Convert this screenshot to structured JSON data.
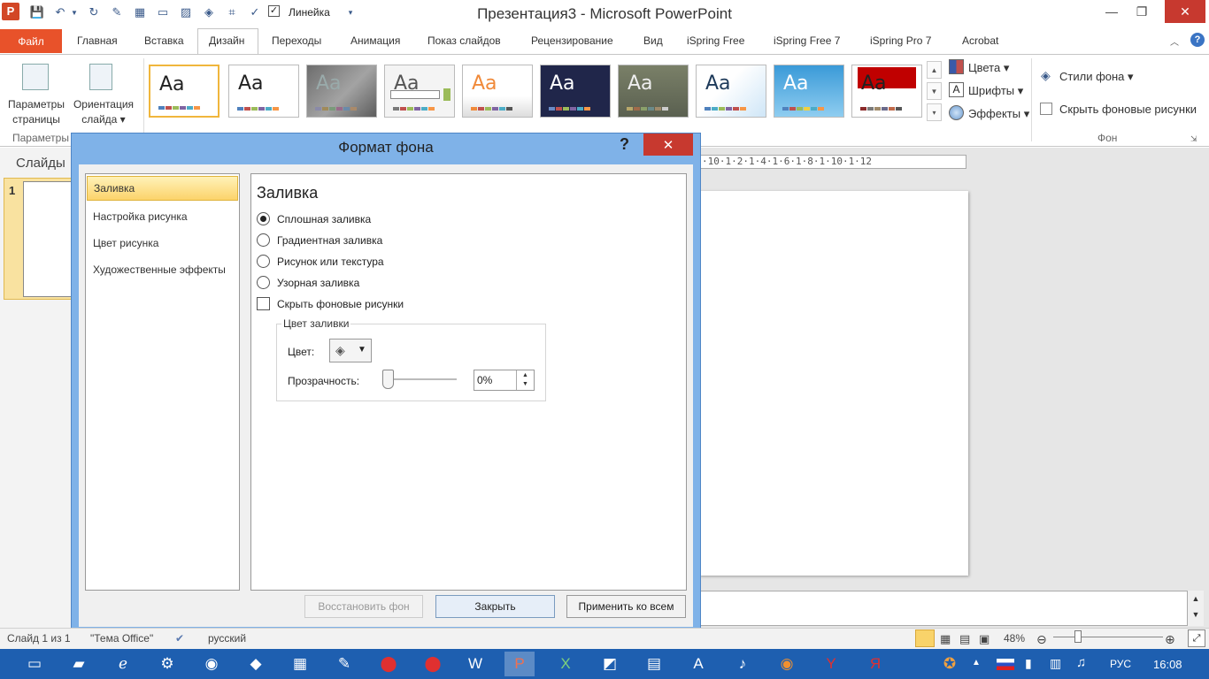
{
  "window": {
    "title": "Презентация3 - Microsoft PowerPoint",
    "app_icon": "P",
    "qat_ruler_label": "Линейка"
  },
  "ribbon": {
    "tabs": [
      {
        "id": "home",
        "label": "Главная"
      },
      {
        "id": "insert",
        "label": "Вставка"
      },
      {
        "id": "design",
        "label": "Дизайн"
      },
      {
        "id": "transitions",
        "label": "Переходы"
      },
      {
        "id": "animation",
        "label": "Анимация"
      },
      {
        "id": "slideshow",
        "label": "Показ слайдов"
      },
      {
        "id": "review",
        "label": "Рецензирование"
      },
      {
        "id": "view",
        "label": "Вид"
      },
      {
        "id": "ispring-free",
        "label": "iSpring Free"
      },
      {
        "id": "ispring-free7",
        "label": "iSpring Free 7"
      },
      {
        "id": "ispring-pro7",
        "label": "iSpring Pro 7"
      },
      {
        "id": "acrobat",
        "label": "Acrobat"
      }
    ],
    "file_tab": "Файл",
    "page_setup": {
      "line1": "Параметры",
      "line2": "страницы"
    },
    "orientation": {
      "line1": "Ориентация",
      "line2": "слайда ▾"
    },
    "group_page_label": "Параметры",
    "theme_sample": "Aa",
    "side_options": {
      "colors": "Цвета ▾",
      "fonts": "Шрифты ▾",
      "effects": "Эффекты ▾",
      "bg_styles": "Стили фона ▾",
      "hide_bg": "Скрыть фоновые рисунки"
    },
    "group_bg_label": "Фон"
  },
  "slides_panel": {
    "title": "Слайды",
    "slide_number": "1"
  },
  "ruler_text": "·10·1·2·1·4·1·6·1·8·1·10·1·12",
  "dialog": {
    "title": "Формат фона",
    "help": "?",
    "close": "✕",
    "nav": [
      "Заливка",
      "Настройка рисунка",
      "Цвет рисунка",
      "Художественные эффекты"
    ],
    "section_title": "Заливка",
    "options": [
      "Сплошная заливка",
      "Градиентная заливка",
      "Рисунок или текстура",
      "Узорная заливка"
    ],
    "hide_bg_label": "Скрыть фоновые рисунки",
    "fill_group_title": "Цвет заливки",
    "color_label": "Цвет:",
    "transparency_label": "Прозрачность:",
    "transparency_value": "0%",
    "buttons": {
      "reset": "Восстановить фон",
      "close": "Закрыть",
      "apply_all": "Применить ко всем"
    }
  },
  "statusbar": {
    "slide_info": "Слайд 1 из 1",
    "theme": "\"Тема Office\"",
    "language": "русский",
    "zoom": "48%"
  },
  "taskbar": {
    "lang": "РУС",
    "time": "16:08"
  },
  "colors": {
    "accent_file": "#e8522a",
    "dialog_frame": "#7fb2e8",
    "taskbar": "#1e5fb0",
    "close_red": "#c7392f"
  }
}
